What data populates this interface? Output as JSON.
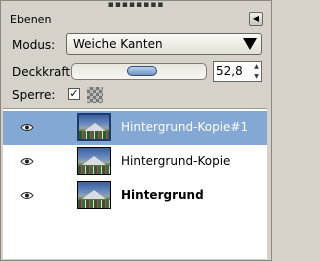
{
  "panel": {
    "title": "Ebenen"
  },
  "mode": {
    "label": "Modus:",
    "value": "Weiche Kanten"
  },
  "opacity": {
    "label": "Deckkraft:",
    "value": "52,8",
    "percent": 52.8
  },
  "lock": {
    "label": "Sperre:",
    "pixels_checked": true
  },
  "layers": [
    {
      "name": "Hintergrund-Kopie#1",
      "visible": true,
      "selected": true
    },
    {
      "name": "Hintergrund-Kopie",
      "visible": true,
      "selected": false
    },
    {
      "name": "Hintergrund",
      "visible": true,
      "selected": false,
      "bold": true
    }
  ],
  "colors": {
    "selection": "#84a8d4",
    "handle": "#6f93c4"
  }
}
